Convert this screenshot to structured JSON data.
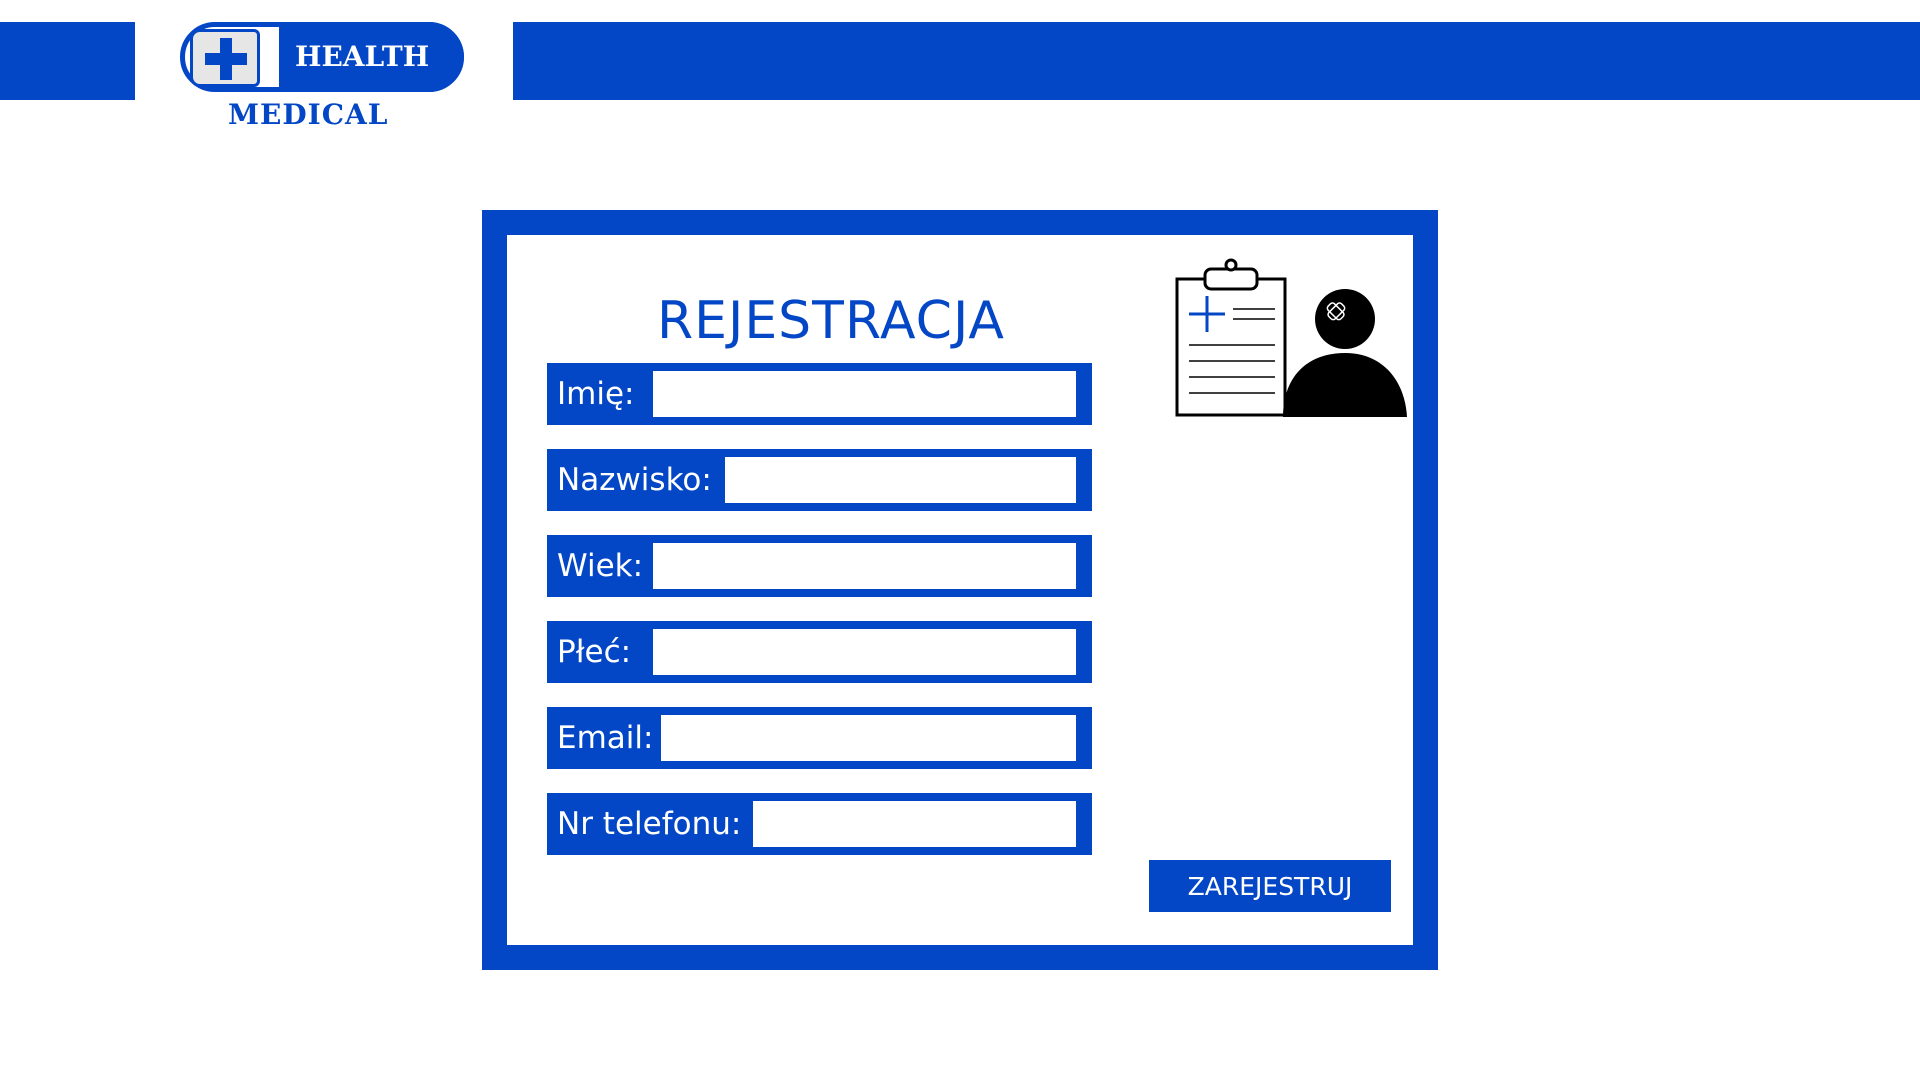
{
  "brand": {
    "top": "HEALTH",
    "bottom": "MEDICAL"
  },
  "form": {
    "title": "REJESTRACJA",
    "fields": [
      {
        "label": "Imię:",
        "value": ""
      },
      {
        "label": "Nazwisko:",
        "value": ""
      },
      {
        "label": "Wiek:",
        "value": ""
      },
      {
        "label": "Płeć:",
        "value": ""
      },
      {
        "label": "Email:",
        "value": ""
      },
      {
        "label": "Nr telefonu:",
        "value": ""
      }
    ],
    "submit_label": "ZAREJESTRUJ"
  },
  "icons": {
    "logo": "medical-cross-icon",
    "illustration": "patient-clipboard-icon"
  },
  "colors": {
    "accent": "#0347c6",
    "background": "#ffffff"
  }
}
